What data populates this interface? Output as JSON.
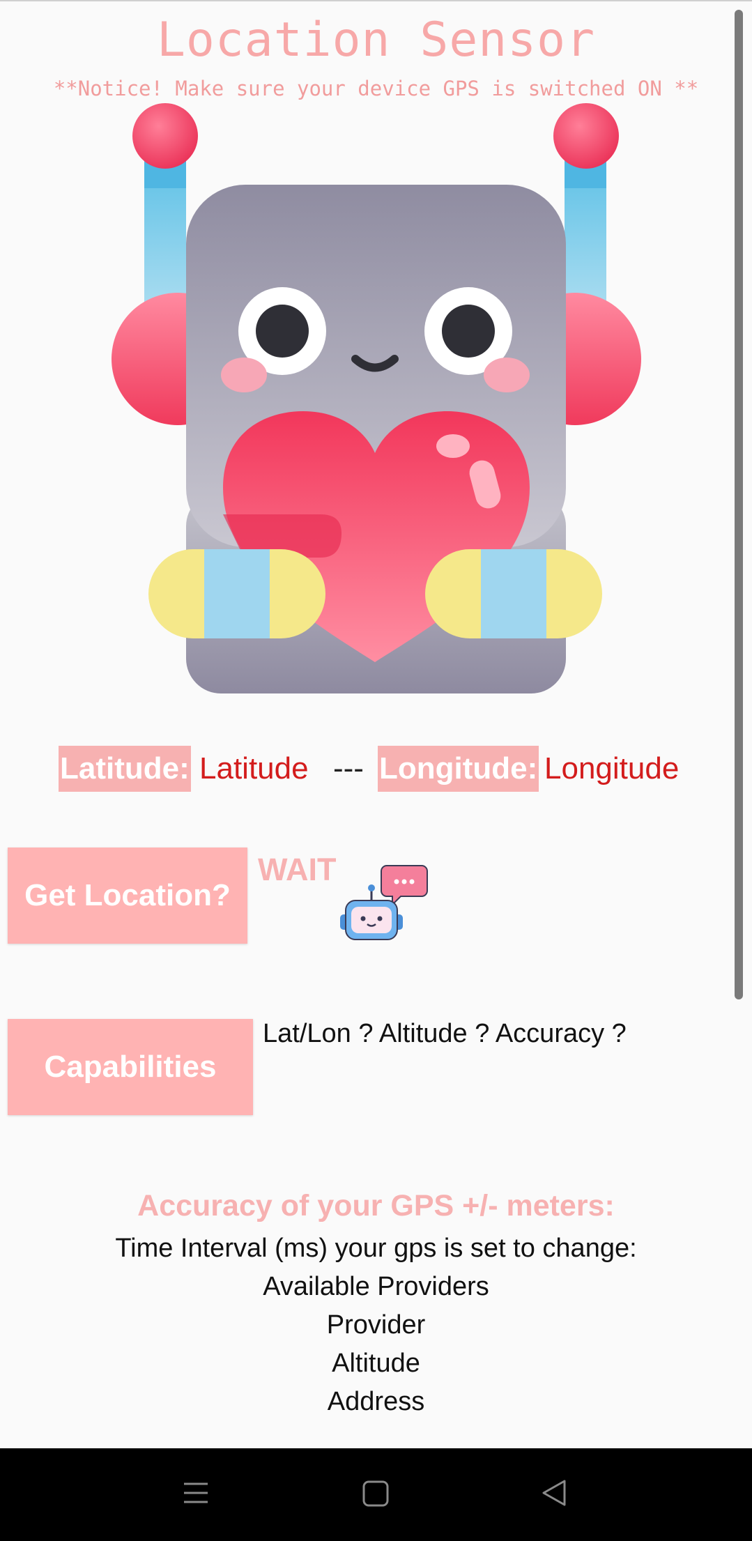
{
  "header": {
    "title": "Location Sensor",
    "notice": "**Notice! Make sure your device GPS is switched ON **"
  },
  "hero": {
    "icon": "robot-holding-heart-icon"
  },
  "coords": {
    "latitude_label": "Latitude:",
    "latitude_value": "Latitude",
    "separator": "---",
    "longitude_label": "Longitude:",
    "longitude_value": "Longitude"
  },
  "location": {
    "button_label": "Get Location?",
    "status": "WAIT",
    "status_icon": "chat-robot-icon"
  },
  "capabilities": {
    "button_label": "Capabilities",
    "text": "Lat/Lon ? Altitude ? Accuracy ?"
  },
  "details": {
    "accuracy_title": "Accuracy of your GPS +/- meters:",
    "time_interval": "Time Interval (ms) your gps is set to change:",
    "providers": "Available Providers",
    "provider": "Provider",
    "altitude": "Altitude",
    "address": "Address"
  },
  "navigation": {
    "menu_icon": "menu-icon",
    "home_icon": "home-square-icon",
    "back_icon": "back-triangle-icon"
  },
  "colors": {
    "accent_pink": "#f7b1b1",
    "button_pink": "#ffb3b3",
    "value_red": "#d31c1c",
    "background": "#fafafa"
  }
}
